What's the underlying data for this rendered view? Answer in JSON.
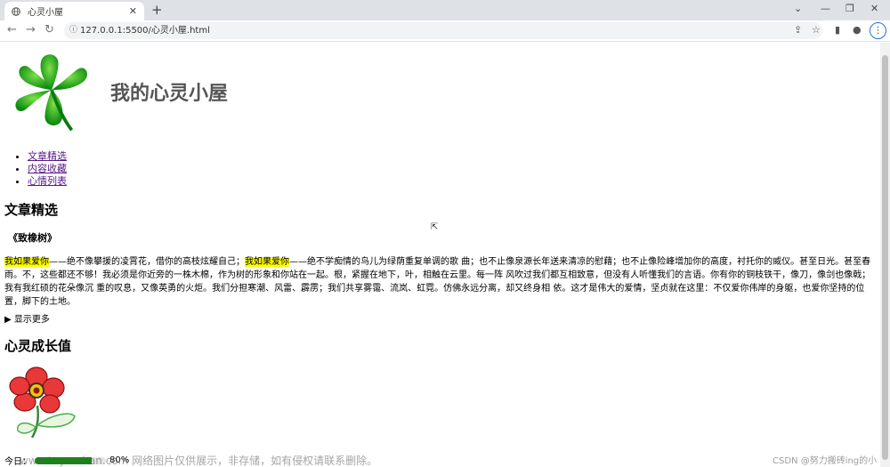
{
  "browser": {
    "tab_title": "心灵小屋",
    "tab_close": "✕",
    "new_tab": "+",
    "url": "127.0.0.1:5500/心灵小屋.html",
    "win_min": "⌄",
    "win_minimize": "—",
    "win_restore": "❐",
    "win_close": "✕",
    "back": "←",
    "forward": "→",
    "reload": "↻",
    "info": "ⓘ",
    "share": "⇪",
    "star": "☆",
    "sidepanel": "▮",
    "profile": "●",
    "menu": "⋮"
  },
  "header": {
    "title": "我的心灵小屋"
  },
  "nav": {
    "items": [
      {
        "label": "文章精选"
      },
      {
        "label": "内容收藏"
      },
      {
        "label": "心情列表"
      }
    ]
  },
  "articles": {
    "heading": "文章精选",
    "poem_title": "《致橡树》",
    "highlight_1": "我如果爱你",
    "text_1": "——绝不像攀援的凌霄花，借你的高枝炫耀自己；",
    "highlight_2": "我如果爱你",
    "text_2": "——绝不学痴情的鸟儿为绿荫重复单调的歌 曲；也不止像泉源长年送来清凉的慰藉；也不止像险峰增加你的高度，衬托你的威仪。甚至日光。甚至春雨。不，这些都还不够！我必须是你近旁的一株木棉，作为树的形象和你站在一起。根，紧握在地下，叶，相触在云里。每一阵 风吹过我们都互相致意，但没有人听懂我们的言语。你有你的铜枝铁干，像刀，像剑也像戟；我有我红硕的花朵像沉 重的叹息，又像英勇的火炬。我们分担寒潮、风雷、霹雳；我们共享雾霭、流岚、虹霓。仿佛永远分离，却又终身相 依。这才是伟大的爱情，坚贞就在这里：不仅爱你伟岸的身躯，也爱你坚持的位置，脚下的土地。",
    "show_more": "显示更多"
  },
  "growth": {
    "heading": "心灵成长值",
    "today_label": "今日：",
    "value_label": "80%",
    "value": 0.8
  },
  "watermark": {
    "text": "www.toymoban.com 网络图片仅供展示，非存储，如有侵权请联系删除。",
    "csdn": "CSDN @努力搬砖ing的小营"
  },
  "colors": {
    "highlight": "#ffff00",
    "meter_fill": "#108a10",
    "title": "#555555",
    "link": "#551a8b"
  }
}
